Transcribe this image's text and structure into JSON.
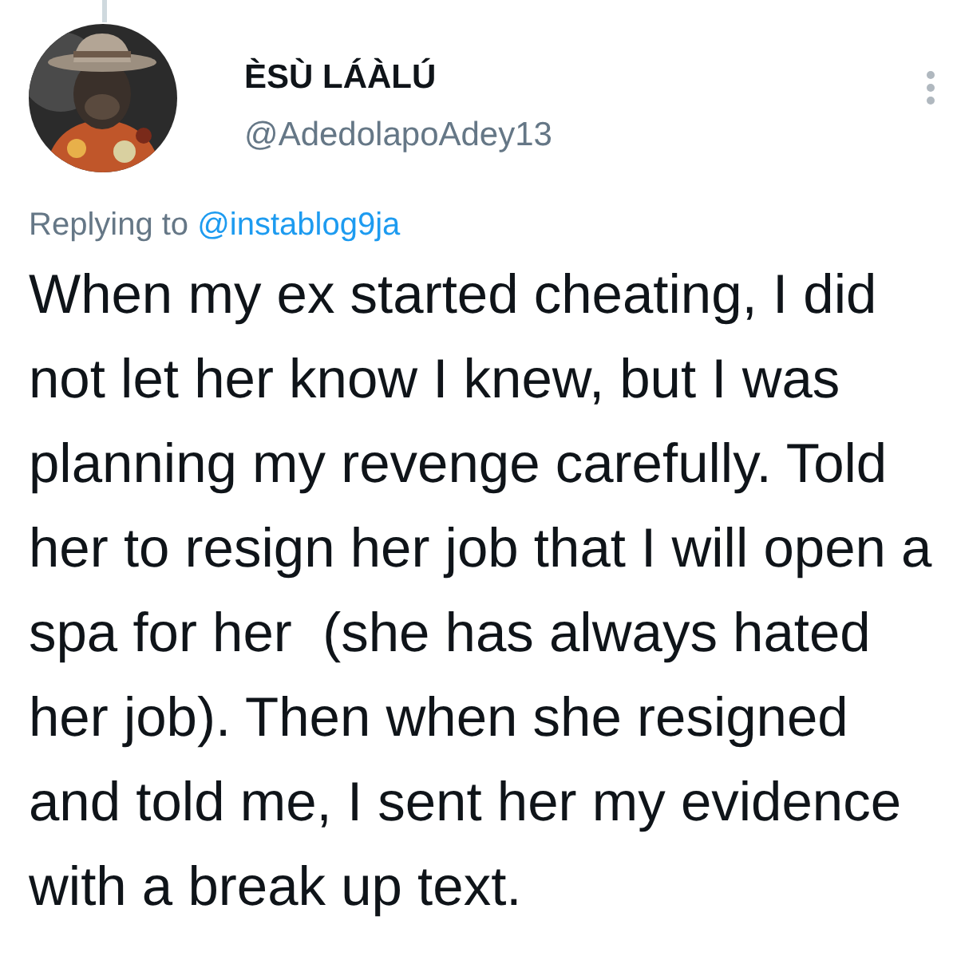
{
  "author": {
    "name": "ÈSÙ LÁÀLÚ",
    "handle": "@AdedolapoAdey13"
  },
  "reply": {
    "prefix": "Replying to",
    "mention": "@instablog9ja"
  },
  "body": "When my ex started cheating, I did not let her know I knew, but I was planning my revenge carefully. Told her to resign her job that I will open a spa for her  (she has always hated her job). Then when she resigned and told me, I sent her my evidence with a break up text."
}
